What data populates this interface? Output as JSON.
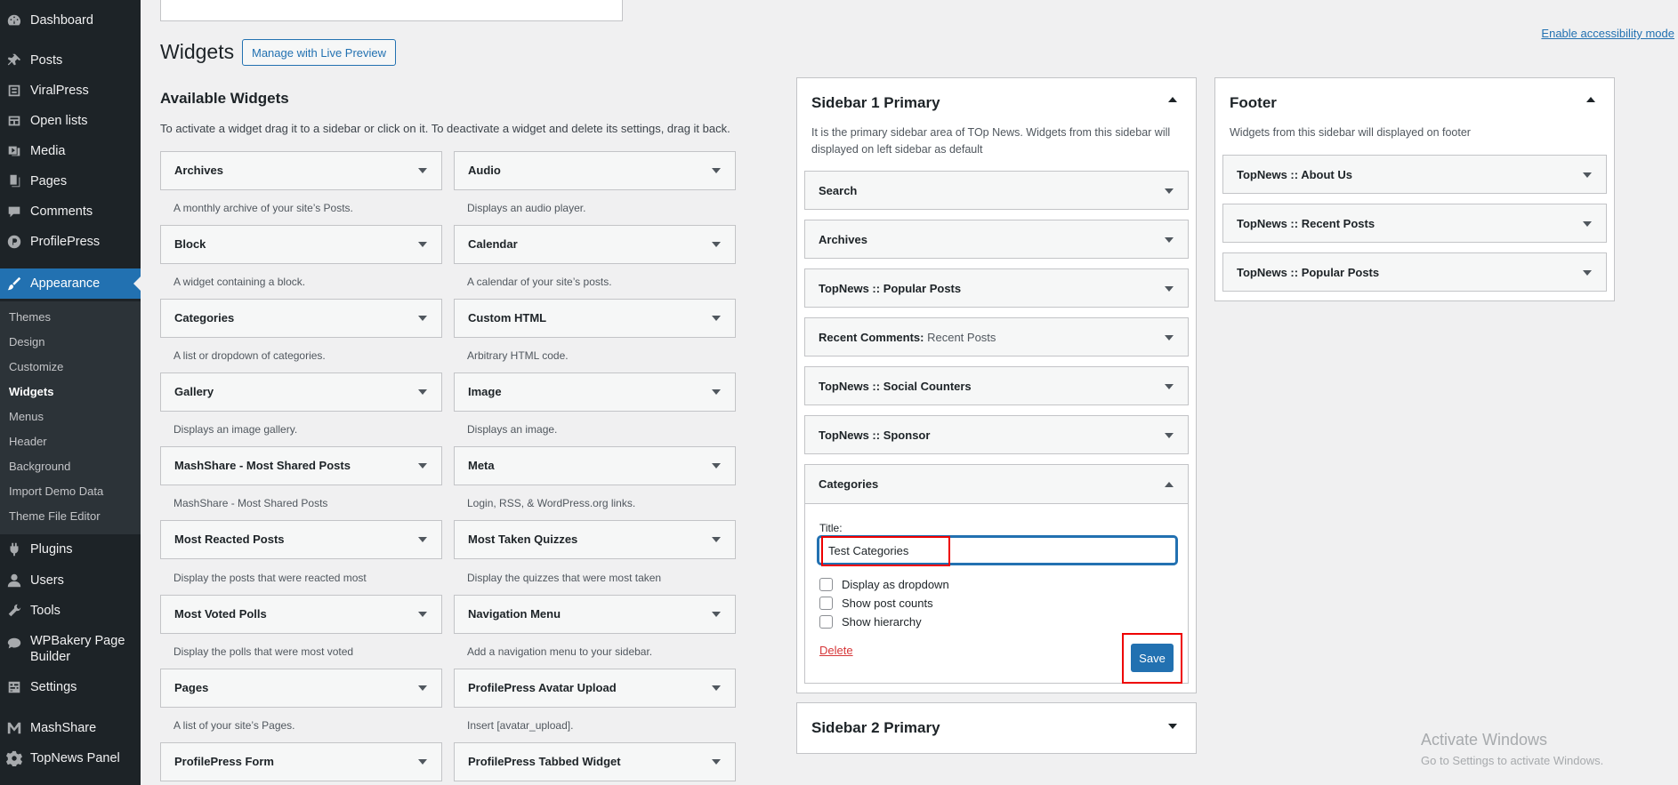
{
  "admin_menu": {
    "items": [
      {
        "label": "Dashboard",
        "icon": "dashboard-icon"
      },
      {
        "label": "Posts",
        "icon": "pin-icon"
      },
      {
        "label": "ViralPress",
        "icon": "viralpress-icon"
      },
      {
        "label": "Open lists",
        "icon": "list-icon"
      },
      {
        "label": "Media",
        "icon": "media-icon"
      },
      {
        "label": "Pages",
        "icon": "pages-icon"
      },
      {
        "label": "Comments",
        "icon": "comment-icon"
      },
      {
        "label": "ProfilePress",
        "icon": "profilepress-icon"
      },
      {
        "label": "Appearance",
        "icon": "brush-icon"
      },
      {
        "label": "Plugins",
        "icon": "plugin-icon"
      },
      {
        "label": "Users",
        "icon": "user-icon"
      },
      {
        "label": "Tools",
        "icon": "wrench-icon"
      },
      {
        "label": "WPBakery Page Builder",
        "icon": "wpbakery-icon"
      },
      {
        "label": "Settings",
        "icon": "settings-icon"
      },
      {
        "label": "MashShare",
        "icon": "mashshare-icon"
      },
      {
        "label": "TopNews Panel",
        "icon": "gear-icon"
      }
    ],
    "submenu": [
      "Themes",
      "Design",
      "Customize",
      "Widgets",
      "Menus",
      "Header",
      "Background",
      "Import Demo Data",
      "Theme File Editor"
    ]
  },
  "header": {
    "title": "Widgets",
    "live_preview": "Manage with Live Preview",
    "accessibility_link": "Enable accessibility mode"
  },
  "available": {
    "title": "Available Widgets",
    "description": "To activate a widget drag it to a sidebar or click on it. To deactivate a widget and delete its settings, drag it back.",
    "widgets": [
      {
        "title": "Archives",
        "desc": "A monthly archive of your site’s Posts."
      },
      {
        "title": "Audio",
        "desc": "Displays an audio player."
      },
      {
        "title": "Block",
        "desc": "A widget containing a block."
      },
      {
        "title": "Calendar",
        "desc": "A calendar of your site’s posts."
      },
      {
        "title": "Categories",
        "desc": "A list or dropdown of categories."
      },
      {
        "title": "Custom HTML",
        "desc": "Arbitrary HTML code."
      },
      {
        "title": "Gallery",
        "desc": "Displays an image gallery."
      },
      {
        "title": "Image",
        "desc": "Displays an image."
      },
      {
        "title": "MashShare - Most Shared Posts",
        "desc": "MashShare - Most Shared Posts"
      },
      {
        "title": "Meta",
        "desc": "Login, RSS, & WordPress.org links."
      },
      {
        "title": "Most Reacted Posts",
        "desc": "Display the posts that were reacted most"
      },
      {
        "title": "Most Taken Quizzes",
        "desc": "Display the quizzes that were most taken"
      },
      {
        "title": "Most Voted Polls",
        "desc": "Display the polls that were most voted"
      },
      {
        "title": "Navigation Menu",
        "desc": "Add a navigation menu to your sidebar."
      },
      {
        "title": "Pages",
        "desc": "A list of your site’s Pages."
      },
      {
        "title": "ProfilePress Avatar Upload",
        "desc": "Insert [avatar_upload]."
      },
      {
        "title": "ProfilePress Form",
        "desc": ""
      },
      {
        "title": "ProfilePress Tabbed Widget",
        "desc": ""
      }
    ]
  },
  "sidebar1": {
    "title": "Sidebar 1 Primary",
    "description": "It is the primary sidebar area of TOp News. Widgets from this sidebar will displayed on left sidebar as default",
    "widgets": [
      {
        "title": "Search",
        "sub": ""
      },
      {
        "title": "Archives",
        "sub": ""
      },
      {
        "title": "TopNews :: Popular Posts",
        "sub": ""
      },
      {
        "title": "Recent Comments:",
        "sub": "Recent Posts"
      },
      {
        "title": "TopNews :: Social Counters",
        "sub": ""
      },
      {
        "title": "TopNews :: Sponsor",
        "sub": ""
      }
    ],
    "open_widget": {
      "title": "Categories",
      "field_label": "Title:",
      "field_value": "Test Categories",
      "checkboxes": [
        "Display as dropdown",
        "Show post counts",
        "Show hierarchy"
      ],
      "delete_label": "Delete",
      "save_label": "Save"
    }
  },
  "sidebar2": {
    "title": "Sidebar 2 Primary"
  },
  "footer": {
    "title": "Footer",
    "description": "Widgets from this sidebar will displayed on footer",
    "widgets": [
      "TopNews :: About Us",
      "TopNews :: Recent Posts",
      "TopNews :: Popular Posts"
    ]
  },
  "watermark": {
    "line1": "Activate Windows",
    "line2": "Go to Settings to activate Windows."
  },
  "colors": {
    "accent": "#2271b1",
    "menu_bg": "#1d2327",
    "highlight": "#e00000"
  }
}
